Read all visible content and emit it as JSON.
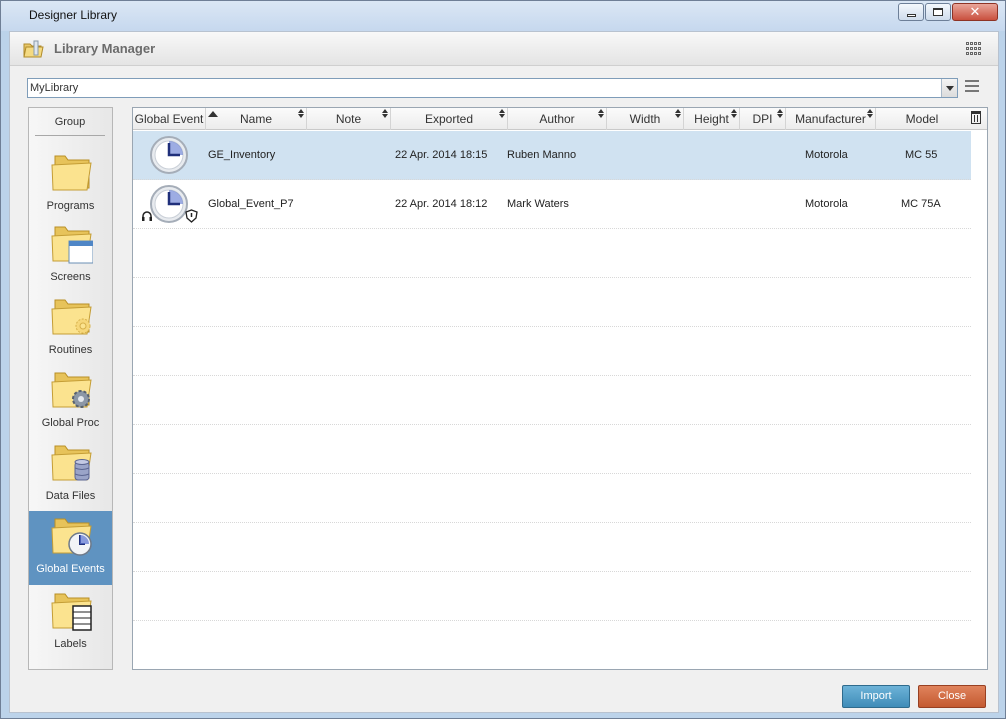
{
  "window": {
    "title": "Designer Library"
  },
  "header": {
    "title": "Library Manager"
  },
  "library_select": {
    "value": "MyLibrary"
  },
  "sidebar": {
    "header": "Group",
    "items": [
      {
        "label": "Programs",
        "icon": "folder-icon",
        "active": false
      },
      {
        "label": "Screens",
        "icon": "folder-screen-icon",
        "active": false
      },
      {
        "label": "Routines",
        "icon": "folder-routine-icon",
        "active": false
      },
      {
        "label": "Global Proc",
        "icon": "folder-gear-icon",
        "active": false
      },
      {
        "label": "Data Files",
        "icon": "folder-database-icon",
        "active": false
      },
      {
        "label": "Global Events",
        "icon": "folder-clock-icon",
        "active": true
      },
      {
        "label": "Labels",
        "icon": "folder-label-icon",
        "active": false
      }
    ]
  },
  "table": {
    "columns": [
      "Global Event",
      "Name",
      "Note",
      "Exported",
      "Author",
      "Width",
      "Height",
      "DPI",
      "Manufacturer",
      "Model"
    ],
    "rows": [
      {
        "name": "GE_Inventory",
        "note": "",
        "exported": "22 Apr. 2014 18:15",
        "author": "Ruben Manno",
        "width": "",
        "height": "",
        "dpi": "",
        "manufacturer": "Motorola",
        "model": "MC 55",
        "selected": true
      },
      {
        "name": "Global_Event_P7",
        "note": "",
        "exported": "22 Apr. 2014 18:12",
        "author": "Mark Waters",
        "width": "",
        "height": "",
        "dpi": "",
        "manufacturer": "Motorola",
        "model": "MC 75A",
        "selected": false
      }
    ]
  },
  "buttons": {
    "import": "Import",
    "close": "Close"
  },
  "colors": {
    "import": "#4a97c2",
    "close": "#d06a3f",
    "selection": "#d0e2f1",
    "sidebar_active": "#5f93c1"
  }
}
